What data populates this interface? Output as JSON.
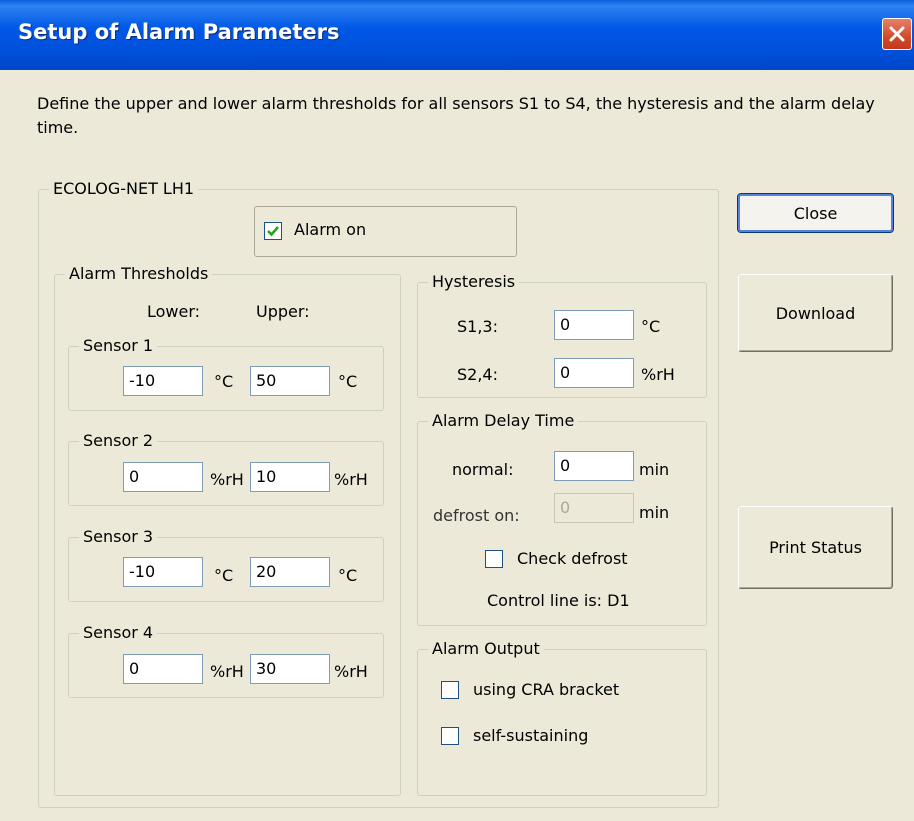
{
  "window": {
    "title": "Setup of Alarm Parameters"
  },
  "description": "Define the upper and lower alarm thresholds for all sensors S1 to S4, the hysteresis and the alarm delay time.",
  "device": {
    "name": "ECOLOG-NET LH1",
    "alarm_on": {
      "label": "Alarm on",
      "checked": true
    }
  },
  "thresholds": {
    "title": "Alarm Thresholds",
    "lower_header": "Lower:",
    "upper_header": "Upper:",
    "sensors": [
      {
        "name": "Sensor 1",
        "lower": "-10",
        "lower_unit": "°C",
        "upper": "50",
        "upper_unit": "°C"
      },
      {
        "name": "Sensor 2",
        "lower": "0",
        "lower_unit": "%rH",
        "upper": "10",
        "upper_unit": "%rH"
      },
      {
        "name": "Sensor 3",
        "lower": "-10",
        "lower_unit": "°C",
        "upper": "20",
        "upper_unit": "°C"
      },
      {
        "name": "Sensor 4",
        "lower": "0",
        "lower_unit": "%rH",
        "upper": "30",
        "upper_unit": "%rH"
      }
    ]
  },
  "hysteresis": {
    "title": "Hysteresis",
    "rows": [
      {
        "label": "S1,3:",
        "value": "0",
        "unit": "°C"
      },
      {
        "label": "S2,4:",
        "value": "0",
        "unit": "%rH"
      }
    ]
  },
  "delay": {
    "title": "Alarm Delay Time",
    "normal_label": "normal:",
    "normal_value": "0",
    "normal_unit": "min",
    "defrost_label": "defrost on:",
    "defrost_value": "0",
    "defrost_unit": "min",
    "check_defrost": {
      "label": "Check defrost",
      "checked": false
    },
    "control_line": "Control line is: D1"
  },
  "output": {
    "title": "Alarm Output",
    "options": [
      {
        "label": "using CRA bracket",
        "checked": false
      },
      {
        "label": "self-sustaining",
        "checked": false
      }
    ]
  },
  "buttons": {
    "close": "Close",
    "download": "Download",
    "print_status": "Print Status"
  },
  "colors": {
    "titlebar": "#0058E6",
    "face": "#ECE9D8",
    "close_button": "#D34A2A"
  }
}
